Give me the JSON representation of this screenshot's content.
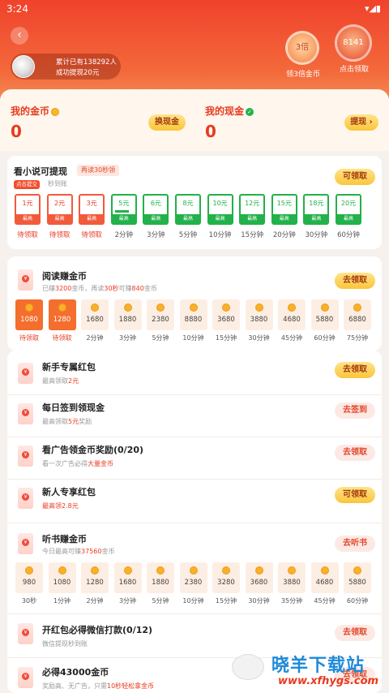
{
  "status_bar": {
    "time": "3:24",
    "icons": "▾◢▮"
  },
  "header": {
    "back_icon": "chevron-left-icon",
    "user_line1": "累计已有138292人",
    "user_line2": "成功提现20元",
    "triple_coin_label": "3倍",
    "triple_coin_caption": "领3倍金币",
    "claim_value": "8141",
    "claim_caption": "点击领取"
  },
  "wallet": {
    "coins_title": "我的金币",
    "coins_value": "0",
    "exchange_button": "换现金",
    "cash_title": "我的现金",
    "cash_value": "0",
    "withdraw_button": "提现 ›"
  },
  "novel": {
    "title": "看小说可提现",
    "tag": "再读30秒领",
    "badge": "点击提交",
    "sub": "秒到账",
    "claim_button": "可领取",
    "packets": [
      {
        "amount": "1元",
        "bar": "最高",
        "label": "待领取",
        "state": "red"
      },
      {
        "amount": "2元",
        "bar": "最高",
        "label": "待领取",
        "state": "red"
      },
      {
        "amount": "3元",
        "bar": "最高",
        "label": "待领取",
        "state": "red"
      },
      {
        "amount": "5元",
        "bar": "最高",
        "label": "2分钟",
        "state": "green",
        "progress": 0.8
      },
      {
        "amount": "6元",
        "bar": "最高",
        "label": "3分钟",
        "state": "green"
      },
      {
        "amount": "8元",
        "bar": "最高",
        "label": "5分钟",
        "state": "green"
      },
      {
        "amount": "10元",
        "bar": "最高",
        "label": "10分钟",
        "state": "green"
      },
      {
        "amount": "12元",
        "bar": "最高",
        "label": "15分钟",
        "state": "green"
      },
      {
        "amount": "15元",
        "bar": "最高",
        "label": "20分钟",
        "state": "green"
      },
      {
        "amount": "18元",
        "bar": "最高",
        "label": "30分钟",
        "state": "green"
      },
      {
        "amount": "20元",
        "bar": "最高",
        "label": "60分钟",
        "state": "green"
      }
    ]
  },
  "reading": {
    "title": "阅读赚金币",
    "sub_a": "已赚",
    "sub_b": "3200",
    "sub_c": "金币，再读",
    "sub_d": "30秒",
    "sub_e": "可赚",
    "sub_f": "840",
    "sub_g": "金币",
    "button": "去领取",
    "coins": [
      {
        "value": "1080",
        "label": "待领取",
        "on": true
      },
      {
        "value": "1280",
        "label": "待领取",
        "on": true
      },
      {
        "value": "1680",
        "label": "2分钟"
      },
      {
        "value": "1880",
        "label": "3分钟"
      },
      {
        "value": "2380",
        "label": "5分钟"
      },
      {
        "value": "8880",
        "label": "10分钟"
      },
      {
        "value": "3680",
        "label": "15分钟"
      },
      {
        "value": "3880",
        "label": "30分钟"
      },
      {
        "value": "4680",
        "label": "45分钟"
      },
      {
        "value": "5880",
        "label": "60分钟"
      },
      {
        "value": "6880",
        "label": "75分钟"
      }
    ]
  },
  "tasks": [
    {
      "title": "新手专属红包",
      "sub_pre": "最高领取",
      "sub_red": "2元",
      "sub_post": "",
      "button": "去领取",
      "style": "yellow"
    },
    {
      "title": "每日签到领现金",
      "sub_pre": "最高领取",
      "sub_red": "5元",
      "sub_post": "奖励",
      "button": "去签到",
      "style": "pink"
    },
    {
      "title": "看广告领金币奖励(0/20)",
      "sub_pre": "看一次广告必得",
      "sub_red": "大量金币",
      "sub_post": "",
      "button": "去领取",
      "style": "pink"
    },
    {
      "title": "新人专享红包",
      "sub_pre": "",
      "sub_red": "最高领2.8元",
      "sub_post": "",
      "button": "可领取",
      "style": "yellow"
    }
  ],
  "listening": {
    "title": "听书赚金币",
    "sub_pre": "今日最高可赚",
    "sub_red": "37560",
    "sub_post": "金币",
    "button": "去听书",
    "coins": [
      {
        "value": "980",
        "label": "30秒"
      },
      {
        "value": "1080",
        "label": "1分钟"
      },
      {
        "value": "1280",
        "label": "2分钟"
      },
      {
        "value": "1680",
        "label": "3分钟"
      },
      {
        "value": "1880",
        "label": "5分钟"
      },
      {
        "value": "2380",
        "label": "10分钟"
      },
      {
        "value": "3280",
        "label": "15分钟"
      },
      {
        "value": "3680",
        "label": "30分钟"
      },
      {
        "value": "3880",
        "label": "35分钟"
      },
      {
        "value": "4680",
        "label": "45分钟"
      },
      {
        "value": "5880",
        "label": "60分钟"
      }
    ]
  },
  "wechat_task": {
    "title": "开红包必得微信打款(0/12)",
    "sub": "微信提现秒到账",
    "button": "去领取"
  },
  "bottom_task": {
    "title": "必得43000金币",
    "sub_pre": "奖励高、无广告，只需",
    "sub_red": "10秒轻松拿金币",
    "button": "去领取"
  },
  "watermark": {
    "site": "晓羊下载站",
    "url": "www.xfhygs.com"
  },
  "colors": {
    "primary_red": "#e83a20",
    "green": "#22b14a",
    "yellow_btn": "#fbc53b"
  }
}
